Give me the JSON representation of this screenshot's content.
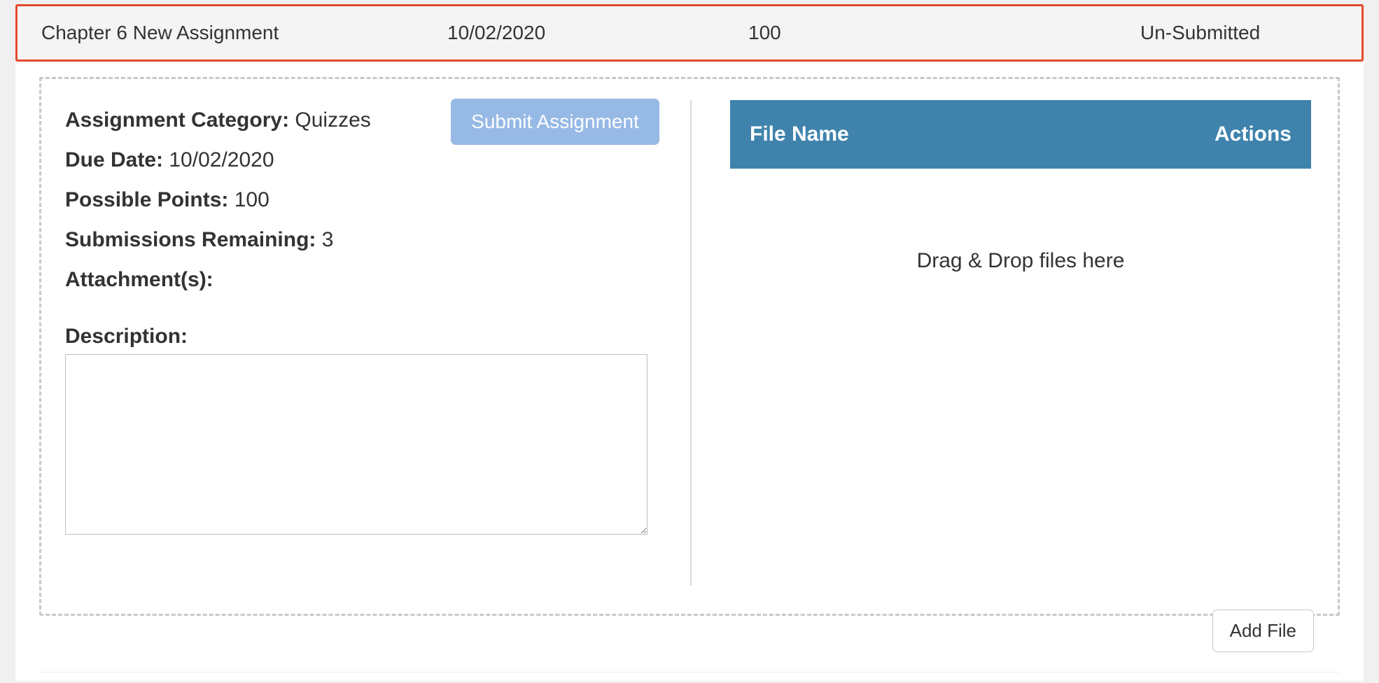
{
  "summary": {
    "name": "Chapter 6 New Assignment",
    "date": "10/02/2020",
    "points": "100",
    "status": "Un-Submitted"
  },
  "details": {
    "category_label": "Assignment Category:",
    "category_value": "Quizzes",
    "due_label": "Due Date:",
    "due_value": "10/02/2020",
    "points_label": "Possible Points:",
    "points_value": "100",
    "submissions_label": "Submissions Remaining:",
    "submissions_value": "3",
    "attachments_label": "Attachment(s):",
    "description_label": "Description:",
    "description_value": ""
  },
  "buttons": {
    "submit": "Submit Assignment",
    "add_file": "Add File"
  },
  "file_panel": {
    "header_name": "File Name",
    "header_actions": "Actions",
    "dropzone_text": "Drag & Drop files here"
  }
}
